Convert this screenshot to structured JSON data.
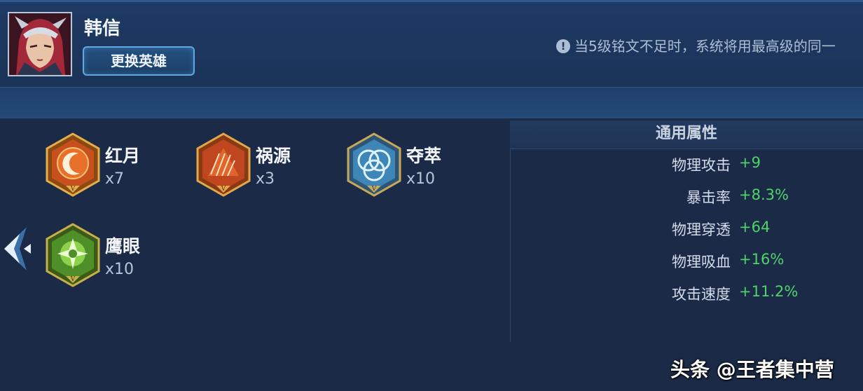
{
  "hero": {
    "name": "韩信",
    "switch_label": "更换英雄"
  },
  "notice": {
    "icon": "info-icon",
    "text": "当5级铭文不足时，系统将用最高级的同一"
  },
  "runes": [
    {
      "name": "红月",
      "count": "x7",
      "color": "#c8501e"
    },
    {
      "name": "祸源",
      "count": "x3",
      "color": "#c0461f"
    },
    {
      "name": "夺萃",
      "count": "x10",
      "color": "#3f86b8"
    },
    {
      "name": "鹰眼",
      "count": "x10",
      "color": "#4f8f2a"
    }
  ],
  "attributes": {
    "title": "通用属性",
    "rows": [
      {
        "name": "物理攻击",
        "value": "+9"
      },
      {
        "name": "暴击率",
        "value": "+8.3%"
      },
      {
        "name": "物理穿透",
        "value": "+64"
      },
      {
        "name": "物理吸血",
        "value": "+16%"
      },
      {
        "name": "攻击速度",
        "value": "+11.2%"
      }
    ]
  },
  "watermark": "头条 @王者集中营"
}
